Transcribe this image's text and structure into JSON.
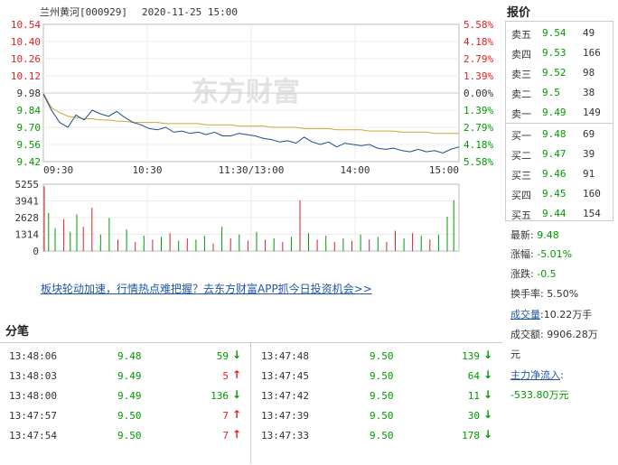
{
  "chart_header": {
    "name": "兰州黄河[000929]",
    "datetime": "2020-11-25 15:00"
  },
  "watermark": "东方财富",
  "chart_data": [
    {
      "type": "line",
      "x_ticks": [
        "09:30",
        "10:30",
        "11:30/13:00",
        "14:00",
        "15:00"
      ],
      "y_left_ticks": [
        "10.54",
        "10.40",
        "10.26",
        "10.12",
        "9.98",
        "9.84",
        "9.70",
        "9.56",
        "9.42"
      ],
      "y_right_ticks": [
        "5.58%",
        "4.18%",
        "2.79%",
        "1.39%",
        "0.00%",
        "1.39%",
        "2.79%",
        "4.18%",
        "5.58%"
      ],
      "ylim": [
        9.42,
        10.54
      ],
      "prev_close": 9.98,
      "series": [
        {
          "name": "",
          "color": "#1a4d8f",
          "values": [
            9.97,
            9.84,
            9.74,
            9.7,
            9.8,
            9.76,
            9.84,
            9.81,
            9.79,
            9.83,
            9.78,
            9.74,
            9.72,
            9.69,
            9.68,
            9.7,
            9.66,
            9.67,
            9.65,
            9.66,
            9.64,
            9.66,
            9.63,
            9.63,
            9.65,
            9.64,
            9.63,
            9.61,
            9.6,
            9.58,
            9.59,
            9.57,
            9.62,
            9.58,
            9.56,
            9.58,
            9.54,
            9.57,
            9.56,
            9.55,
            9.56,
            9.53,
            9.52,
            9.53,
            9.51,
            9.5,
            9.52,
            9.5,
            9.51,
            9.49,
            9.52,
            9.54
          ]
        },
        {
          "name": "",
          "color": "#c9a83a",
          "values": [
            9.98,
            9.86,
            9.82,
            9.79,
            9.78,
            9.77,
            9.77,
            9.76,
            9.76,
            9.75,
            9.75,
            9.74,
            9.74,
            9.74,
            9.74,
            9.73,
            9.73,
            9.73,
            9.73,
            9.73,
            9.72,
            9.72,
            9.72,
            9.72,
            9.71,
            9.71,
            9.71,
            9.71,
            9.7,
            9.7,
            9.7,
            9.7,
            9.69,
            9.69,
            9.69,
            9.69,
            9.68,
            9.68,
            9.68,
            9.68,
            9.67,
            9.67,
            9.67,
            9.67,
            9.66,
            9.66,
            9.66,
            9.66,
            9.65,
            9.65,
            9.65,
            9.65
          ]
        }
      ]
    },
    {
      "type": "bar",
      "y_ticks": [
        "5255",
        "3941",
        "2628",
        "1314",
        "0"
      ],
      "ylim": [
        0,
        5255
      ],
      "bars": [
        {
          "i": 0,
          "v": 5100,
          "c": "red"
        },
        {
          "i": 2,
          "v": 3000,
          "c": "green"
        },
        {
          "i": 5,
          "v": 1800,
          "c": "green"
        },
        {
          "i": 9,
          "v": 2500,
          "c": "red"
        },
        {
          "i": 12,
          "v": 1500,
          "c": "green"
        },
        {
          "i": 15,
          "v": 2900,
          "c": "green"
        },
        {
          "i": 18,
          "v": 1900,
          "c": "red"
        },
        {
          "i": 22,
          "v": 3400,
          "c": "red"
        },
        {
          "i": 26,
          "v": 1300,
          "c": "green"
        },
        {
          "i": 30,
          "v": 2600,
          "c": "green"
        },
        {
          "i": 34,
          "v": 900,
          "c": "red"
        },
        {
          "i": 38,
          "v": 1700,
          "c": "green"
        },
        {
          "i": 42,
          "v": 700,
          "c": "red"
        },
        {
          "i": 46,
          "v": 1200,
          "c": "green"
        },
        {
          "i": 50,
          "v": 900,
          "c": "red"
        },
        {
          "i": 54,
          "v": 1100,
          "c": "green"
        },
        {
          "i": 58,
          "v": 1400,
          "c": "red"
        },
        {
          "i": 62,
          "v": 800,
          "c": "green"
        },
        {
          "i": 66,
          "v": 1000,
          "c": "red"
        },
        {
          "i": 70,
          "v": 900,
          "c": "green"
        },
        {
          "i": 74,
          "v": 1200,
          "c": "green"
        },
        {
          "i": 78,
          "v": 600,
          "c": "red"
        },
        {
          "i": 82,
          "v": 1900,
          "c": "green"
        },
        {
          "i": 86,
          "v": 1000,
          "c": "red"
        },
        {
          "i": 90,
          "v": 1300,
          "c": "green"
        },
        {
          "i": 94,
          "v": 800,
          "c": "red"
        },
        {
          "i": 98,
          "v": 1500,
          "c": "green"
        },
        {
          "i": 102,
          "v": 900,
          "c": "red"
        },
        {
          "i": 106,
          "v": 1000,
          "c": "green"
        },
        {
          "i": 110,
          "v": 700,
          "c": "red"
        },
        {
          "i": 114,
          "v": 1100,
          "c": "green"
        },
        {
          "i": 118,
          "v": 4000,
          "c": "red"
        },
        {
          "i": 122,
          "v": 1400,
          "c": "green"
        },
        {
          "i": 126,
          "v": 900,
          "c": "red"
        },
        {
          "i": 130,
          "v": 1200,
          "c": "green"
        },
        {
          "i": 134,
          "v": 700,
          "c": "red"
        },
        {
          "i": 138,
          "v": 1000,
          "c": "green"
        },
        {
          "i": 142,
          "v": 800,
          "c": "red"
        },
        {
          "i": 146,
          "v": 1300,
          "c": "green"
        },
        {
          "i": 150,
          "v": 900,
          "c": "red"
        },
        {
          "i": 154,
          "v": 1100,
          "c": "green"
        },
        {
          "i": 158,
          "v": 700,
          "c": "red"
        },
        {
          "i": 162,
          "v": 1600,
          "c": "red"
        },
        {
          "i": 166,
          "v": 1000,
          "c": "green"
        },
        {
          "i": 170,
          "v": 1400,
          "c": "red"
        },
        {
          "i": 174,
          "v": 1200,
          "c": "green"
        },
        {
          "i": 178,
          "v": 900,
          "c": "red"
        },
        {
          "i": 182,
          "v": 1300,
          "c": "green"
        },
        {
          "i": 186,
          "v": 2700,
          "c": "green"
        },
        {
          "i": 189,
          "v": 4000,
          "c": "green"
        }
      ]
    }
  ],
  "promo_text": "板块轮动加速，行情热点难把握？去东方财富APP抓今日投资机会>>",
  "ticks": {
    "title": "分笔",
    "left": [
      {
        "time": "13:48:06",
        "price": "9.48",
        "vol": "59",
        "dir": "down"
      },
      {
        "time": "13:48:03",
        "price": "9.49",
        "vol": "5",
        "dir": "up"
      },
      {
        "time": "13:48:00",
        "price": "9.49",
        "vol": "136",
        "dir": "down"
      },
      {
        "time": "13:47:57",
        "price": "9.50",
        "vol": "7",
        "dir": "up"
      },
      {
        "time": "13:47:54",
        "price": "9.50",
        "vol": "7",
        "dir": "up"
      }
    ],
    "right": [
      {
        "time": "13:47:48",
        "price": "9.50",
        "vol": "139",
        "dir": "down"
      },
      {
        "time": "13:47:45",
        "price": "9.50",
        "vol": "64",
        "dir": "down"
      },
      {
        "time": "13:47:42",
        "price": "9.50",
        "vol": "11",
        "dir": "down"
      },
      {
        "time": "13:47:39",
        "price": "9.50",
        "vol": "30",
        "dir": "down"
      },
      {
        "time": "13:47:33",
        "price": "9.50",
        "vol": "178",
        "dir": "down"
      }
    ]
  },
  "quote": {
    "title": "报价",
    "asks": [
      {
        "label": "卖五",
        "price": "9.54",
        "vol": "49"
      },
      {
        "label": "卖四",
        "price": "9.53",
        "vol": "166"
      },
      {
        "label": "卖三",
        "price": "9.52",
        "vol": "98"
      },
      {
        "label": "卖二",
        "price": "9.5",
        "vol": "38"
      },
      {
        "label": "卖一",
        "price": "9.49",
        "vol": "149"
      }
    ],
    "bids": [
      {
        "label": "买一",
        "price": "9.48",
        "vol": "69"
      },
      {
        "label": "买二",
        "price": "9.47",
        "vol": "39"
      },
      {
        "label": "买三",
        "price": "9.46",
        "vol": "91"
      },
      {
        "label": "买四",
        "price": "9.45",
        "vol": "160"
      },
      {
        "label": "买五",
        "price": "9.44",
        "vol": "154"
      }
    ],
    "latest_label": "最新:",
    "latest": "9.48",
    "change_pct_label": "涨幅:",
    "change_pct": "-5.01%",
    "change_label": "涨跌:",
    "change": "-0.5",
    "turnover_label": "换手率:",
    "turnover": "5.50%",
    "volume_label": "成交量",
    "volume": ":10.22万手",
    "amount_label": "成交额:",
    "amount": "9906.28万",
    "amount_unit": "元",
    "inflow_label": "主力净流入",
    "inflow_colon": ":",
    "inflow": "-533.80万元"
  },
  "colors": {
    "up": "#e02020",
    "down": "#009900",
    "link": "#2255aa"
  }
}
